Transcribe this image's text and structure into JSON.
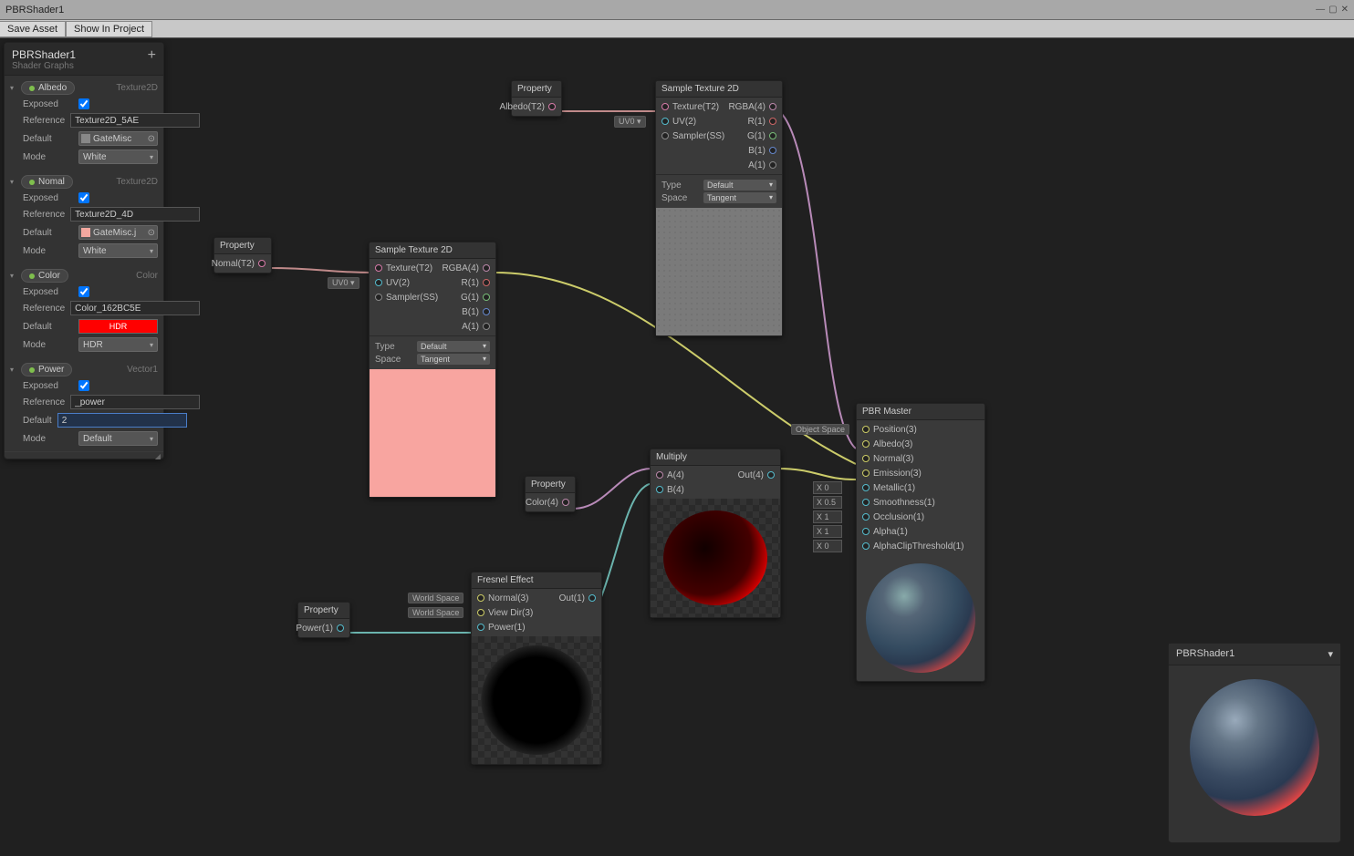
{
  "window": {
    "title": "PBRShader1"
  },
  "toolbar": {
    "save": "Save Asset",
    "show": "Show In Project"
  },
  "blackboard": {
    "title": "PBRShader1",
    "subtitle": "Shader Graphs",
    "props": [
      {
        "name": "Albedo",
        "type": "Texture2D",
        "exposed": true,
        "reference": "Texture2D_5AE",
        "default": "GateMisc",
        "mode": "White",
        "swatch": "grey"
      },
      {
        "name": "Nomal",
        "type": "Texture2D",
        "exposed": true,
        "reference": "Texture2D_4D",
        "default": "GateMisc.j",
        "mode": "White",
        "swatch": "pink"
      },
      {
        "name": "Color",
        "type": "Color",
        "exposed": true,
        "reference": "Color_162BC5E",
        "default": "HDR",
        "mode": "HDR"
      },
      {
        "name": "Power",
        "type": "Vector1",
        "exposed": true,
        "reference": "_power",
        "default": "2",
        "mode": "Default"
      }
    ],
    "labels": {
      "exposed": "Exposed",
      "reference": "Reference",
      "default": "Default",
      "mode": "Mode"
    }
  },
  "nodes": {
    "prop_albedo": {
      "title": "Property",
      "out": "Albedo(T2)"
    },
    "prop_normal": {
      "title": "Property",
      "out": "Nomal(T2)"
    },
    "prop_color": {
      "title": "Property",
      "out": "Color(4)"
    },
    "prop_power": {
      "title": "Property",
      "out": "Power(1)"
    },
    "sample1": {
      "title": "Sample Texture 2D",
      "ins": [
        {
          "l": "Texture(T2)"
        },
        {
          "l": "UV(2)",
          "tag": "UV0 ▾"
        },
        {
          "l": "Sampler(SS)"
        }
      ],
      "outs": [
        "RGBA(4)",
        "R(1)",
        "G(1)",
        "B(1)",
        "A(1)"
      ],
      "type": "Default",
      "space": "Tangent"
    },
    "sample2": {
      "title": "Sample Texture 2D",
      "ins": [
        {
          "l": "Texture(T2)"
        },
        {
          "l": "UV(2)",
          "tag": "UV0 ▾"
        },
        {
          "l": "Sampler(SS)"
        }
      ],
      "outs": [
        "RGBA(4)",
        "R(1)",
        "G(1)",
        "B(1)",
        "A(1)"
      ],
      "type": "Default",
      "space": "Tangent"
    },
    "multiply": {
      "title": "Multiply",
      "ins": [
        "A(4)",
        "B(4)"
      ],
      "out": "Out(4)"
    },
    "fresnel": {
      "title": "Fresnel Effect",
      "ins": [
        {
          "l": "Normal(3)",
          "tag": "World Space"
        },
        {
          "l": "View Dir(3)",
          "tag": "World Space"
        },
        {
          "l": "Power(1)"
        }
      ],
      "out": "Out(1)"
    },
    "master": {
      "title": "PBR Master",
      "space_tag": "Object Space",
      "ins": [
        {
          "l": "Position(3)"
        },
        {
          "l": "Albedo(3)"
        },
        {
          "l": "Normal(3)"
        },
        {
          "l": "Emission(3)"
        },
        {
          "l": "Metallic(1)",
          "x": "X 0"
        },
        {
          "l": "Smoothness(1)",
          "x": "X 0.5"
        },
        {
          "l": "Occlusion(1)",
          "x": "X 1"
        },
        {
          "l": "Alpha(1)",
          "x": "X 1"
        },
        {
          "l": "AlphaClipThreshold(1)",
          "x": "X 0"
        }
      ]
    }
  },
  "labels": {
    "type": "Type",
    "space": "Space"
  },
  "preview": {
    "title": "PBRShader1"
  }
}
